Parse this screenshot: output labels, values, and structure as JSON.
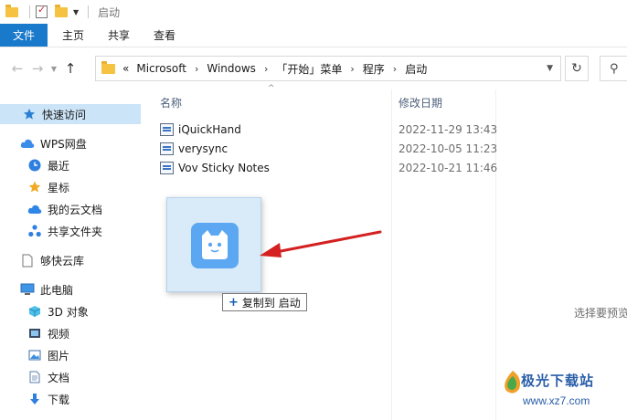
{
  "window": {
    "title": "启动"
  },
  "ribbon": {
    "tabs": [
      "文件",
      "主页",
      "共享",
      "查看"
    ]
  },
  "address": {
    "overflow": "«",
    "crumbs": [
      "Microsoft",
      "Windows",
      "「开始」菜单",
      "程序",
      "启动"
    ]
  },
  "sidebar": {
    "items": [
      {
        "label": "快速访问",
        "icon": "pin-icon"
      },
      {
        "label": "WPS网盘",
        "icon": "cloud-icon"
      },
      {
        "label": "最近",
        "icon": "clock-icon"
      },
      {
        "label": "星标",
        "icon": "star-icon"
      },
      {
        "label": "我的云文档",
        "icon": "cloud-doc-icon"
      },
      {
        "label": "共享文件夹",
        "icon": "share-icon"
      },
      {
        "label": "够快云库",
        "icon": "document-icon"
      },
      {
        "label": "此电脑",
        "icon": "computer-icon"
      },
      {
        "label": "3D 对象",
        "icon": "cube-icon"
      },
      {
        "label": "视频",
        "icon": "video-icon"
      },
      {
        "label": "图片",
        "icon": "picture-icon"
      },
      {
        "label": "文档",
        "icon": "document-icon"
      },
      {
        "label": "下载",
        "icon": "download-icon"
      }
    ]
  },
  "columns": {
    "name": "名称",
    "date": "修改日期"
  },
  "files": [
    {
      "name": "iQuickHand",
      "date": "2022-11-29 13:43"
    },
    {
      "name": "verysync",
      "date": "2022-10-05 11:23"
    },
    {
      "name": "Vov Sticky Notes",
      "date": "2022-10-21 11:46"
    }
  ],
  "drag": {
    "tooltip": "复制到 启动",
    "plus": "+"
  },
  "preview": {
    "hint": "选择要预览"
  },
  "watermark": {
    "brand": "极光下载站",
    "url": "www.xz7.com"
  },
  "colors": {
    "accent": "#1979ca",
    "selected": "#cce4f7",
    "arrow": "#d42020"
  }
}
